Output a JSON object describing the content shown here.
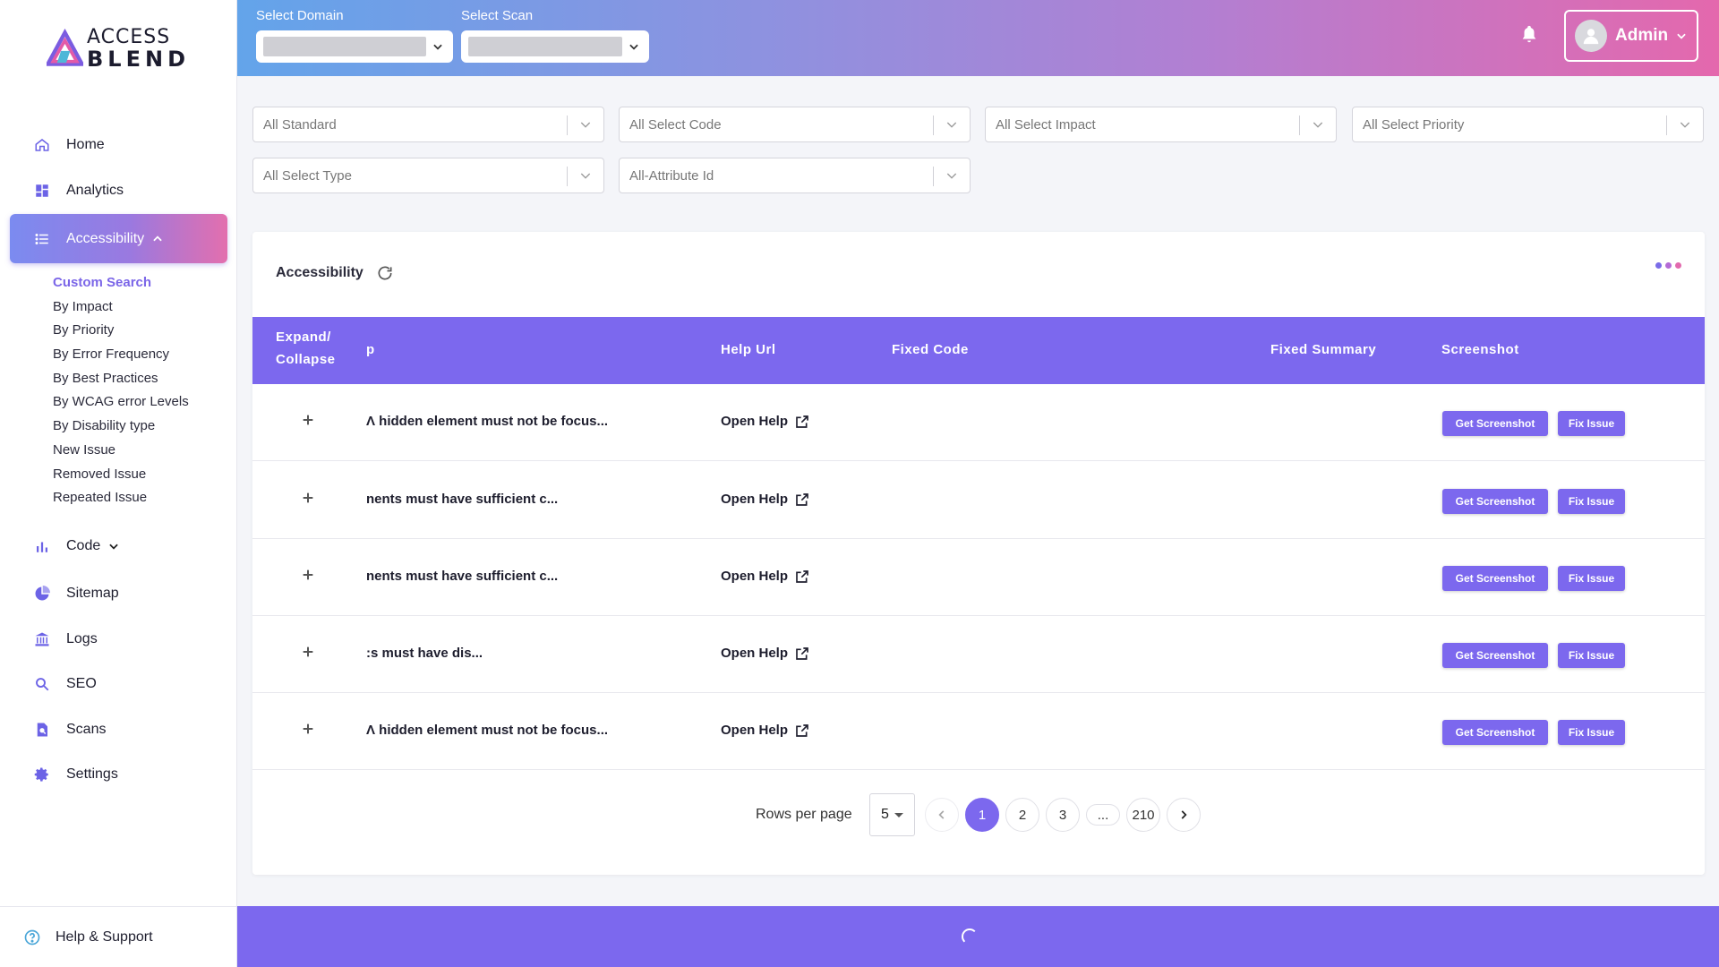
{
  "brand": {
    "line1": "ACCESS",
    "line2": "BLEND"
  },
  "nav": {
    "home": "Home",
    "analytics": "Analytics",
    "accessibility": "Accessibility",
    "code": "Code",
    "sitemap": "Sitemap",
    "logs": "Logs",
    "seo": "SEO",
    "scans": "Scans",
    "settings": "Settings"
  },
  "subnav": [
    "Custom Search",
    "By Impact",
    "By Priority",
    "By Error Frequency",
    "By Best Practices",
    "By WCAG error Levels",
    "By Disability type",
    "New Issue",
    "Removed Issue",
    "Repeated Issue"
  ],
  "help_support": "Help & Support",
  "header": {
    "domain_label": "Select Domain",
    "scan_label": "Select Scan",
    "user": "Admin"
  },
  "filters": {
    "standard": "All Standard",
    "code": "All Select Code",
    "impact": "All Select Impact",
    "priority": "All Select Priority",
    "type": "All Select Type",
    "attribute": "All-Attribute Id"
  },
  "card": {
    "title": "Accessibility"
  },
  "table": {
    "headers": {
      "expand_1": "Expand/",
      "expand_2": "Collapse",
      "description": "p",
      "help_url": "Help Url",
      "fixed_code": "Fixed Code",
      "fixed_summary": "Fixed Summary",
      "screenshot": "Screenshot"
    },
    "rows": [
      {
        "description": "Ʌ hidden element must not be focus...",
        "help": "Open Help",
        "screenshot_btn": "Get Screenshot",
        "fix_btn": "Fix Issue"
      },
      {
        "description": "nents must have sufficient c...",
        "help": "Open Help",
        "screenshot_btn": "Get Screenshot",
        "fix_btn": "Fix Issue"
      },
      {
        "description": "nents must have sufficient c...",
        "help": "Open Help",
        "screenshot_btn": "Get Screenshot",
        "fix_btn": "Fix Issue"
      },
      {
        "description": ":s must have dis...",
        "help": "Open Help",
        "screenshot_btn": "Get Screenshot",
        "fix_btn": "Fix Issue"
      },
      {
        "description": "Ʌ hidden element must not be focus...",
        "help": "Open Help",
        "screenshot_btn": "Get Screenshot",
        "fix_btn": "Fix Issue"
      }
    ]
  },
  "pagination": {
    "rows_per_page_label": "Rows per page",
    "rows_per_page": "5",
    "pages": [
      "1",
      "2",
      "3",
      "...",
      "210"
    ],
    "current": "1"
  },
  "colors": {
    "accent": "#7c68ee",
    "gradient_start": "#63a4ea",
    "gradient_end": "#e468ad"
  }
}
